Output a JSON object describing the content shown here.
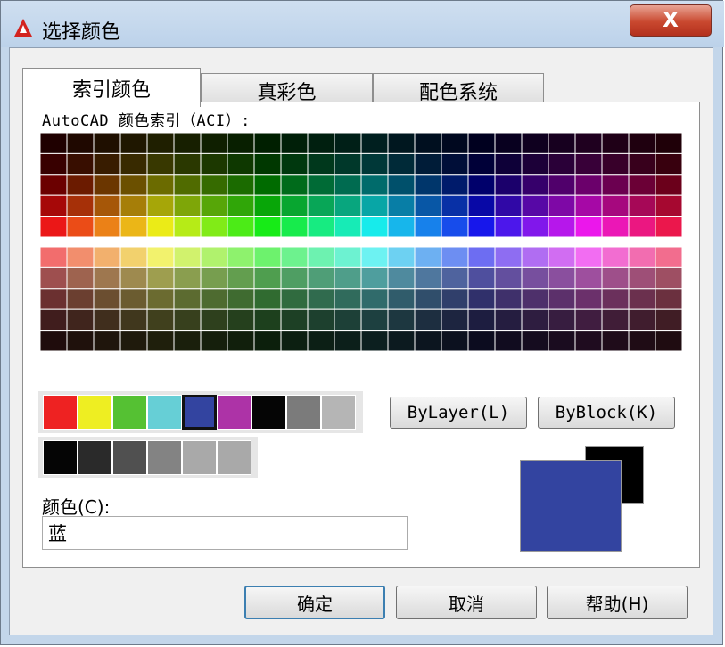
{
  "window": {
    "title": "选择颜色",
    "close_label": "X"
  },
  "tabs": [
    {
      "label": "索引颜色",
      "active": true
    },
    {
      "label": "真彩色",
      "active": false
    },
    {
      "label": "配色系统",
      "active": false
    }
  ],
  "aci": {
    "label": "AutoCAD 颜色索引（ACI）:"
  },
  "standard_colors": {
    "row1": [
      "#ee2222",
      "#eeee22",
      "#55c133",
      "#66cfd6",
      "#3344a0",
      "#ad33a7",
      "#050505",
      "#7b7b7b",
      "#b5b5b5"
    ],
    "row2": [
      "#050505",
      "#2a2a2a",
      "#505050",
      "#838383",
      "#a9a9a9",
      "#a9a9a9"
    ],
    "selected_color": "#3344a0"
  },
  "buttons": {
    "bylayer": "ByLayer(L)",
    "byblock": "ByBlock(K)",
    "ok": "确定",
    "cancel": "取消",
    "help": "帮助(H)"
  },
  "color_field": {
    "label": "颜色(C):",
    "value": "蓝"
  },
  "preview": {
    "old_color": "#000000",
    "new_color": "#3344a0"
  }
}
